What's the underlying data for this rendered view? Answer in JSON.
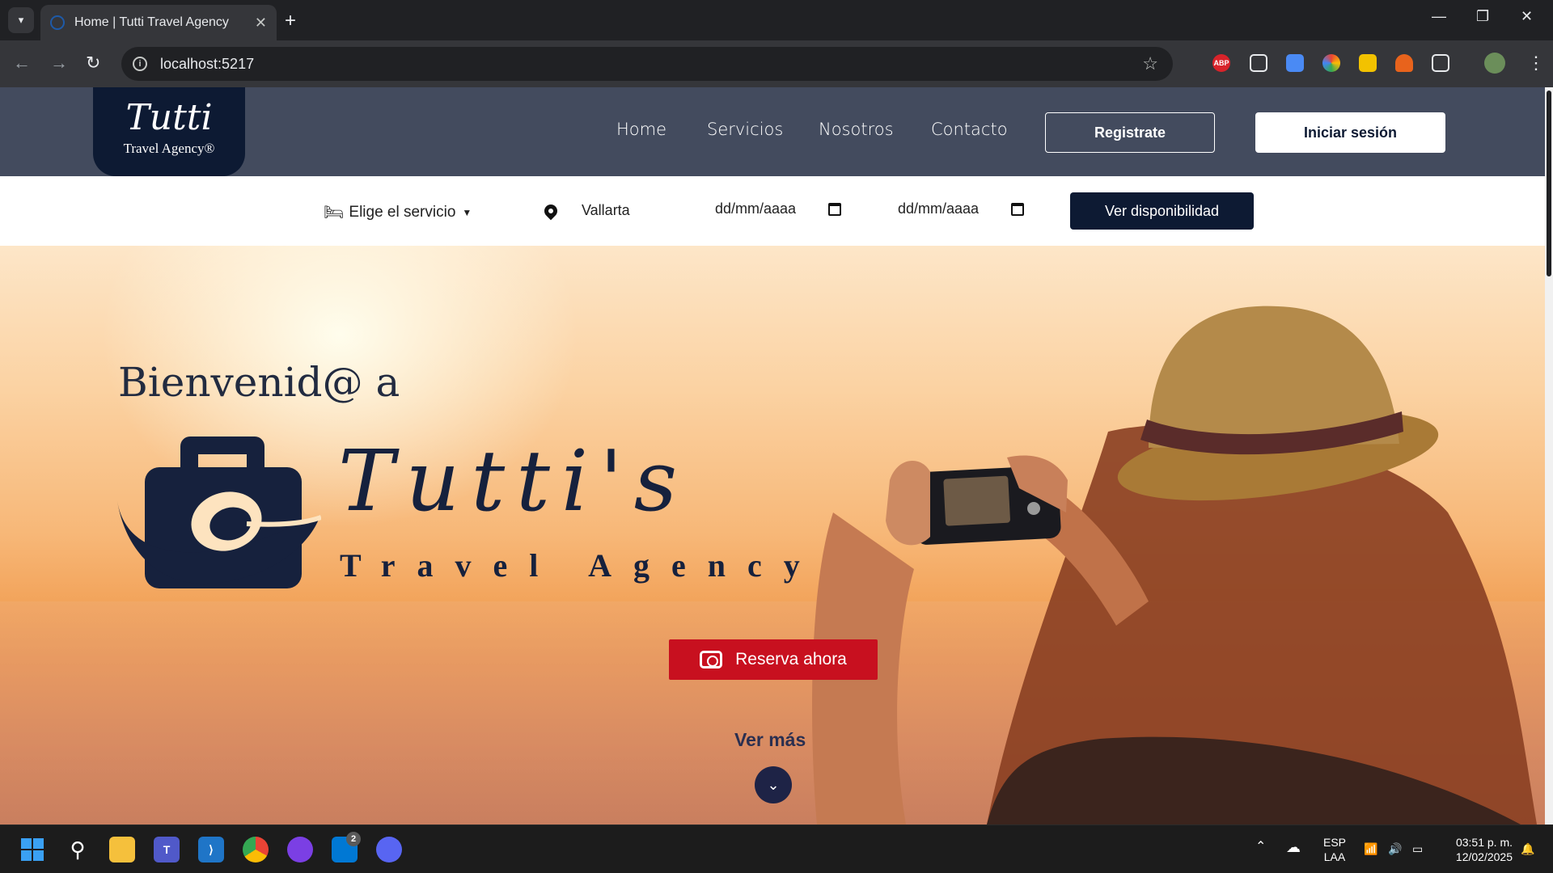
{
  "browser": {
    "tab_title": "Home | Tutti Travel Agency",
    "url": "localhost:5217",
    "extensions": [
      "ABP"
    ]
  },
  "site": {
    "logo_script": "Tutti",
    "logo_sub": "Travel Agency®",
    "nav": [
      "Home",
      "Servicios",
      "Nosotros",
      "Contacto"
    ],
    "register_label": "Registrate",
    "login_label": "Iniciar sesión"
  },
  "search": {
    "service_label": "Elige el servicio",
    "location_value": "Vallarta",
    "date_from_placeholder": "dd/mm/aaaa",
    "date_to_placeholder": "dd/mm/aaaa",
    "submit_label": "Ver disponibilidad"
  },
  "hero": {
    "welcome": "Bienvenid@ a",
    "brand_script": "Tutti's",
    "brand_sub": "Travel Agency",
    "cta_label": "Reserva ahora",
    "more_label": "Ver más"
  },
  "taskbar": {
    "lang_top": "ESP",
    "lang_bottom": "LAA",
    "time": "03:51 p. m.",
    "date": "12/02/2025",
    "store_badge": "2"
  },
  "colors": {
    "navy": "#0d1a33",
    "header": "#434b5e",
    "cta_red": "#c8101f"
  }
}
